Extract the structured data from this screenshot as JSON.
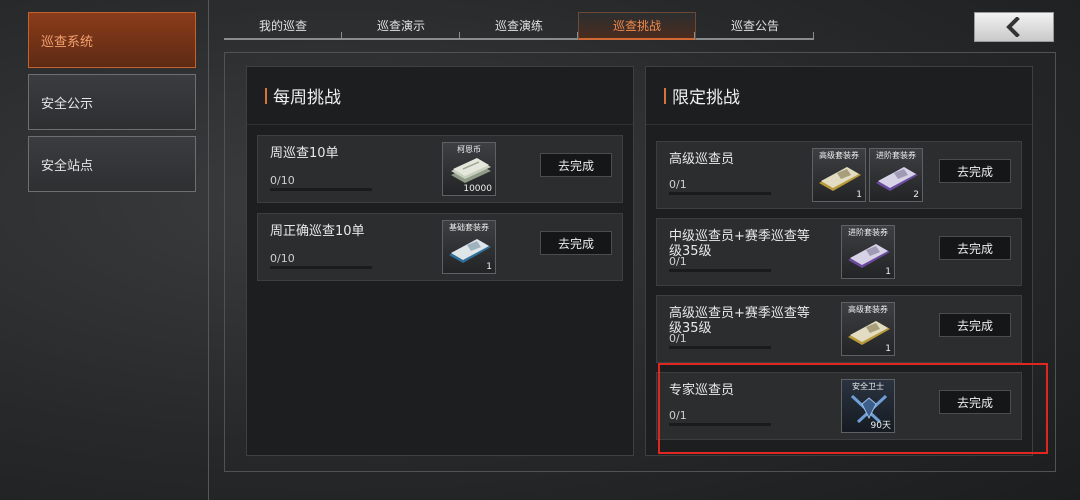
{
  "sidebar": {
    "items": [
      {
        "label": "巡查系统",
        "active": true
      },
      {
        "label": "安全公示",
        "active": false
      },
      {
        "label": "安全站点",
        "active": false
      }
    ]
  },
  "tabs": [
    {
      "label": "我的巡查",
      "active": false
    },
    {
      "label": "巡查演示",
      "active": false
    },
    {
      "label": "巡查演练",
      "active": false
    },
    {
      "label": "巡查挑战",
      "active": true
    },
    {
      "label": "巡查公告",
      "active": false
    }
  ],
  "back_button": {
    "icon": "chevron-left-icon"
  },
  "weekly": {
    "title": "每周挑战",
    "tasks": [
      {
        "name": "周巡查10单",
        "progress": "0/10",
        "button": "去完成",
        "rewards": [
          {
            "label": "柯恩币",
            "count": "10000",
            "icon": "cash-stack-icon"
          }
        ]
      },
      {
        "name": "周正确巡查10单",
        "progress": "0/10",
        "button": "去完成",
        "rewards": [
          {
            "label": "基础套装券",
            "count": "1",
            "icon": "blue-ticket-icon"
          }
        ]
      }
    ]
  },
  "limited": {
    "title": "限定挑战",
    "tasks": [
      {
        "name": "高级巡查员",
        "progress": "0/1",
        "button": "去完成",
        "rewards": [
          {
            "label": "高级套装券",
            "count": "1",
            "icon": "gold-ticket-icon"
          },
          {
            "label": "进阶套装券",
            "count": "2",
            "icon": "purple-ticket-icon"
          }
        ]
      },
      {
        "name": "中级巡查员+赛季巡查等级35级",
        "progress": "0/1",
        "button": "去完成",
        "rewards": [
          {
            "label": "进阶套装券",
            "count": "1",
            "icon": "purple-ticket-icon"
          }
        ]
      },
      {
        "name": "高级巡查员+赛季巡查等级35级",
        "progress": "0/1",
        "button": "去完成",
        "rewards": [
          {
            "label": "高级套装券",
            "count": "1",
            "icon": "gold-ticket-icon"
          }
        ]
      },
      {
        "name": "专家巡查员",
        "progress": "0/1",
        "button": "去完成",
        "rewards": [
          {
            "label": "安全卫士",
            "count": "90天",
            "icon": "guardian-badge-icon"
          }
        ]
      }
    ]
  },
  "colors": {
    "accent": "#d9733b",
    "highlight": "#e0271f"
  }
}
